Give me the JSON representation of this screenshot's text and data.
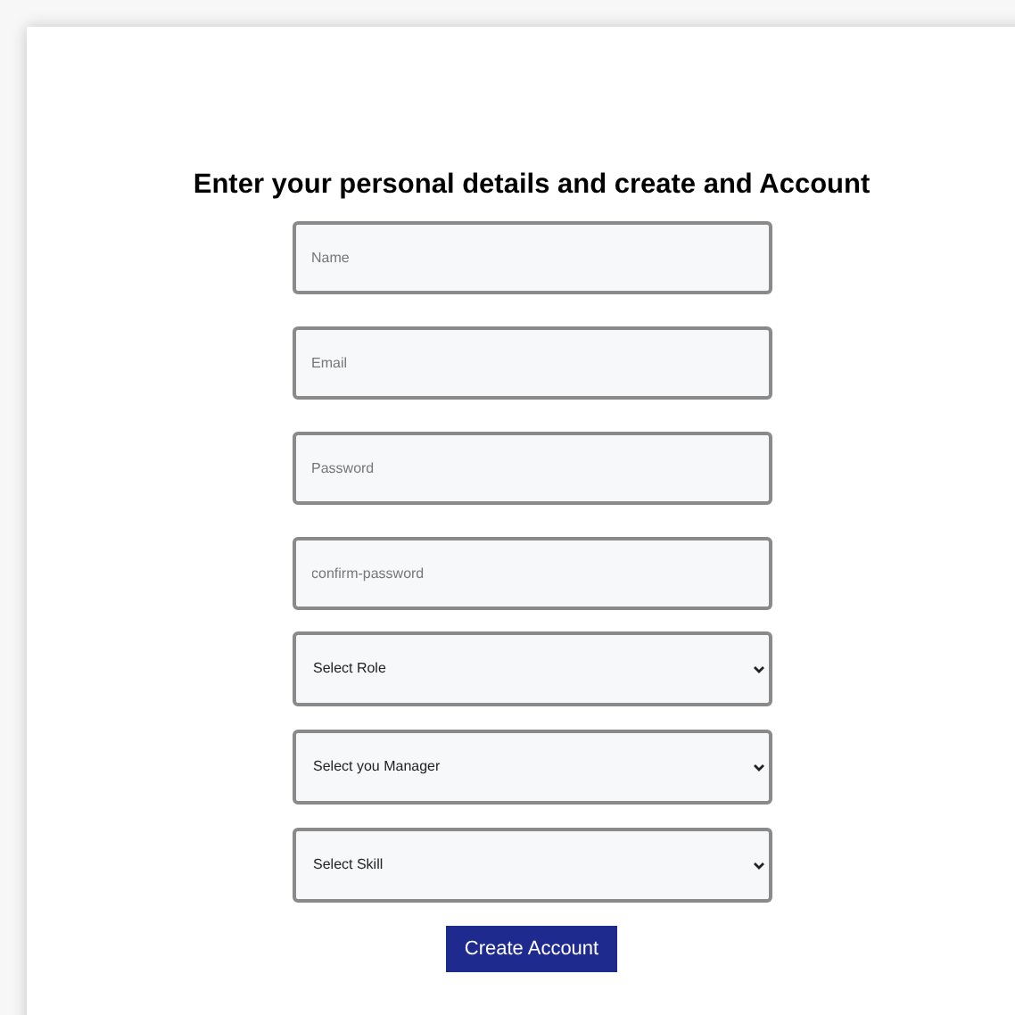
{
  "heading": "Enter your personal details and create and Account",
  "fields": [
    {
      "kind": "input",
      "placeholder": "Name"
    },
    {
      "kind": "input",
      "placeholder": "Email"
    },
    {
      "kind": "input",
      "placeholder": "Password"
    },
    {
      "kind": "input",
      "placeholder": "confirm-password"
    },
    {
      "kind": "select",
      "value": "Select Role"
    },
    {
      "kind": "select",
      "value": "Select you Manager"
    },
    {
      "kind": "select",
      "value": "Select Skill"
    }
  ],
  "submit_button": "Create Account"
}
